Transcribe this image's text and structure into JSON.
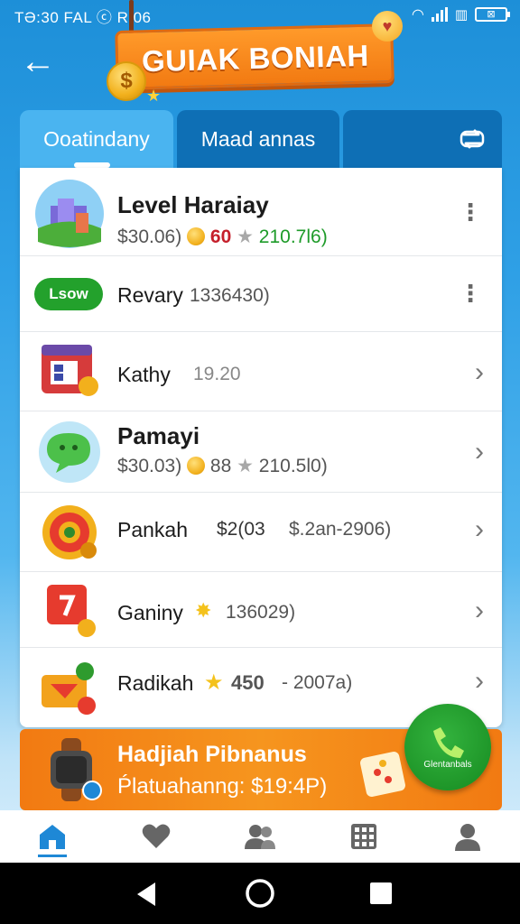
{
  "status_bar": {
    "time": "TƏ:30 FAL ⓒ R 06",
    "battery": "⊠"
  },
  "header": {
    "title": "GUIAK BONIAH",
    "coin_symbol": "$"
  },
  "tabs": [
    {
      "label": "Ooatindany"
    },
    {
      "label": "Maad annas"
    },
    {
      "label": "",
      "icon": "swap-icon"
    }
  ],
  "rows": [
    {
      "title": "Level Haraiay",
      "price": "$30.06)",
      "coins": "60",
      "rating": "210.7l6)",
      "action": "more"
    },
    {
      "pill": "Lsow",
      "title": "Revary",
      "value": "1336430)",
      "action": "more"
    },
    {
      "title": "Kathy",
      "value": "19.20",
      "action": "chevron"
    },
    {
      "title": "Pamayi",
      "price": "$30.03)",
      "coins": "88",
      "rating": "210.5l0)",
      "action": "chevron"
    },
    {
      "title": "Pankah",
      "value": "$2(03",
      "extra": "$.2an-2906)",
      "action": "chevron"
    },
    {
      "title": "Ganiny",
      "value": "136029)",
      "action": "chevron"
    },
    {
      "title": "Radikah",
      "coins": "450",
      "value": "- 2007a)",
      "action": "chevron"
    }
  ],
  "promo": {
    "line1": "Hadjiah Pibnanus",
    "line2": "Ṕlatuahanng: $19:4P)"
  },
  "fab": {
    "label": "Glentanbals"
  },
  "colors": {
    "accent_orange": "#f27a12",
    "accent_blue": "#1e88d6",
    "green": "#23a12c"
  }
}
